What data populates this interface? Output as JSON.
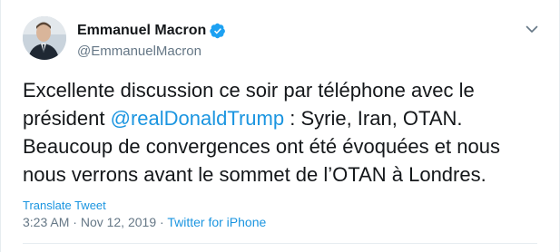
{
  "author": {
    "name": "Emmanuel Macron",
    "handle": "@EmmanuelMacron",
    "verified": true,
    "avatar_icon": "avatar-photo"
  },
  "tweet": {
    "text_part1": "Excellente discussion ce soir par téléphone avec le président ",
    "mention": "@realDonaldTrump",
    "text_part2": " : Syrie, Iran, OTAN. Beaucoup de convergences ont été évoquées et nous nous verrons avant le sommet de l’OTAN à Londres.",
    "translate_label": "Translate Tweet"
  },
  "meta": {
    "time": "3:23 AM",
    "separator": " · ",
    "date": "Nov 12, 2019",
    "source": "Twitter for iPhone"
  },
  "icons": {
    "verified": "verified-badge-icon",
    "more": "chevron-down-icon"
  },
  "colors": {
    "link": "#1b95e0",
    "muted": "#657786",
    "text": "#14171a",
    "verified": "#1da1f2"
  }
}
